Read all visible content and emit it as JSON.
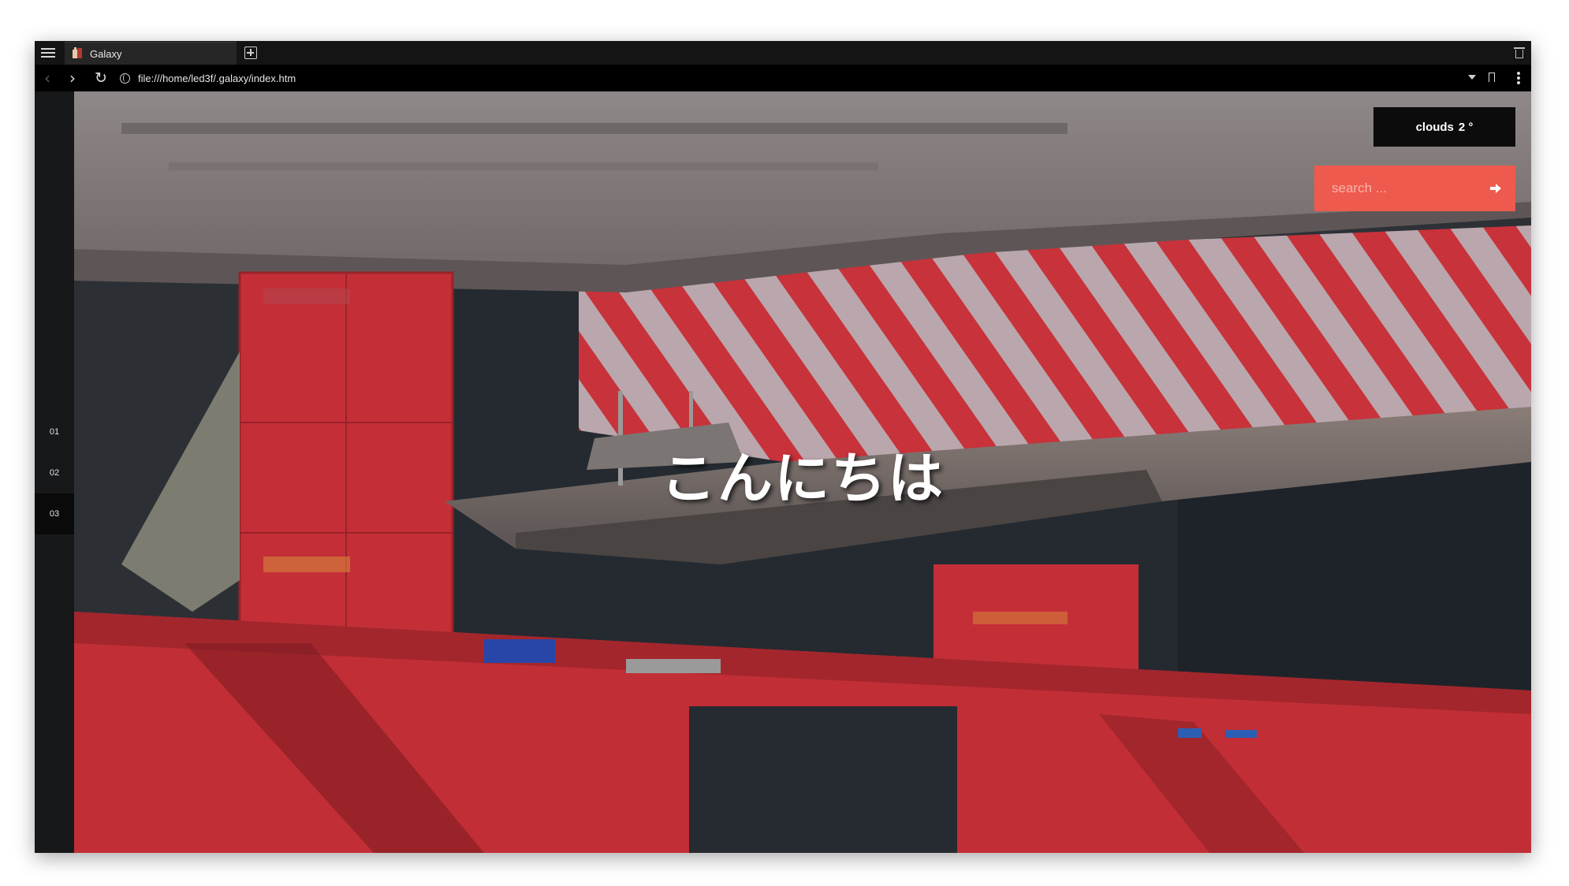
{
  "browser": {
    "tab_title": "Galaxy",
    "url": "file:///home/led3f/.galaxy/index.htm",
    "icons": {
      "menu": "hamburger-menu-icon",
      "new_tab": "plus-square-icon",
      "trash": "trash-icon",
      "back": "chevron-left-icon",
      "forward": "chevron-right-icon",
      "reload": "reload-icon",
      "site_info": "globe-icon",
      "url_dropdown": "triangle-down-icon",
      "bookmark": "bookmark-icon",
      "more": "kebab-menu-icon"
    }
  },
  "sidebar": {
    "items": [
      {
        "label": "01",
        "active": false
      },
      {
        "label": "02",
        "active": false
      },
      {
        "label": "03",
        "active": true
      }
    ]
  },
  "hero": {
    "greeting": "こんにちは"
  },
  "weather": {
    "condition": "clouds",
    "temperature": "2 °"
  },
  "search": {
    "placeholder": "search ...",
    "submit_icon": "arrow-right-icon"
  },
  "colors": {
    "accent": "#ee5a4d",
    "hull_red": "#c8323a",
    "stripe_light": "#b9a7ad"
  }
}
